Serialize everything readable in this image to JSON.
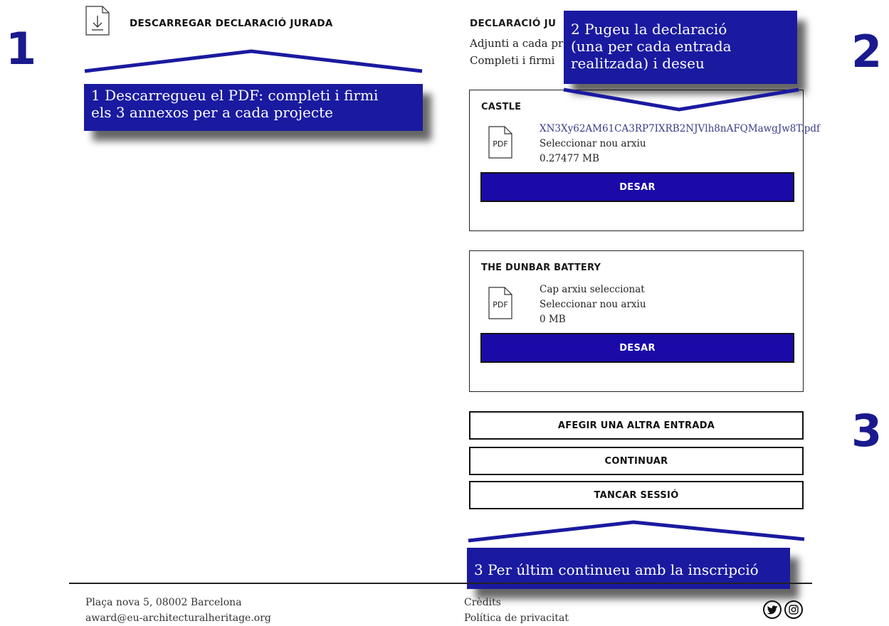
{
  "steps": [
    "1",
    "2",
    "3"
  ],
  "download": {
    "label": "DESCARREGAR DECLARACIÓ JURADA",
    "icon": "download-file-icon"
  },
  "annotations": {
    "note1": [
      "1 Descarregueu el PDF: completi i firmi",
      "els 3 annexos per a cada projecte"
    ],
    "note2": [
      "2 Pugeu la declaració",
      "(una per cada entrada",
      "realitzada) i deseu"
    ],
    "note3": "3 Per últim continueu amb la inscripció"
  },
  "declaration": {
    "title": "DECLARACIÓ JU",
    "line1": "Adjunti a cada pr",
    "line2": "Completi i firmi"
  },
  "entries": [
    {
      "title": "CASTLE",
      "file": "XN3Xy62AM61CA3RP7IXRB2NJVlh8nAFQMawgJw8T.pdf",
      "select": "Seleccionar nou arxiu",
      "size": "0.27477 MB",
      "save": "DESAR"
    },
    {
      "title": "THE DUNBAR BATTERY",
      "file": "Cap arxiu seleccionat",
      "select": "Seleccionar nou arxiu",
      "size": "0 MB",
      "save": "DESAR"
    }
  ],
  "pdf_icon_label": "PDF",
  "actions": {
    "add_entry": "AFEGIR UNA ALTRA ENTRADA",
    "continue": "CONTINUAR",
    "logout": "TANCAR SESSIÓ"
  },
  "footer": {
    "address": "Plaça nova 5, 08002 Barcelona",
    "email": "award@eu-architecturalheritage.org",
    "credits": "Crèdits",
    "privacy": "Política de privacitat",
    "social": [
      "twitter-icon",
      "instagram-icon"
    ]
  },
  "colors": {
    "accent": "#1a0aa8",
    "note_bg": "#1a1aa0",
    "step": "#1a1a8e"
  }
}
